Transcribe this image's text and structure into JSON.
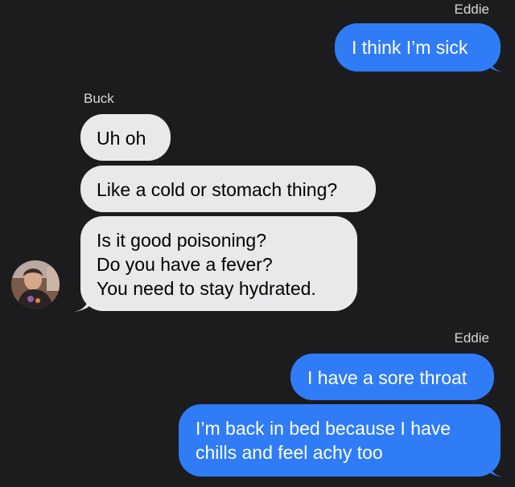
{
  "conversation": {
    "sender_top": "Eddie",
    "msg_out_1": "I think I’m sick",
    "sender_buck": "Buck",
    "msg_in_1": "Uh oh",
    "msg_in_2": "Like a cold or stomach thing?",
    "msg_in_3": {
      "line1": "Is it good poisoning?",
      "line2": "Do you have a fever?",
      "line3": "You need to stay hydrated."
    },
    "sender_eddie_2": "Eddie",
    "msg_out_2": "I have a sore throat",
    "msg_out_3": {
      "line1": "I’m back in bed because I have",
      "line2": "chills and feel achy too"
    }
  },
  "colors": {
    "background": "#1c1c1e",
    "incoming_bubble": "#e9e9eb",
    "outgoing_bubble": "#2f7cf6",
    "sender_label": "#d8d8dc"
  },
  "icons": {
    "contact_avatar": "avatar-photo"
  }
}
